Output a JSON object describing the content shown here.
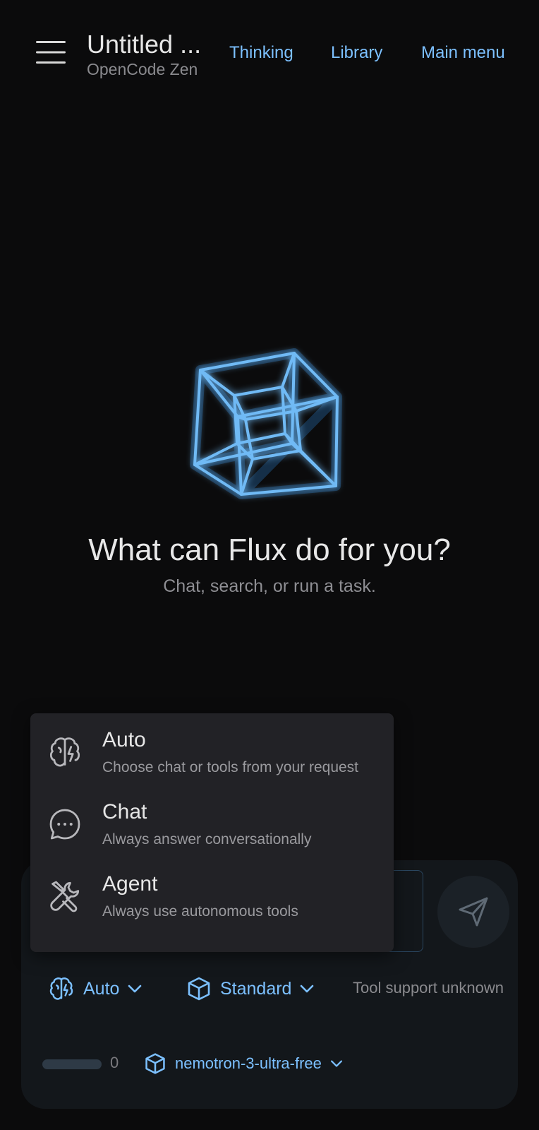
{
  "header": {
    "menu_icon": "hamburger-icon",
    "title": "Untitled ...",
    "subtitle": "OpenCode Zen",
    "nav": {
      "thinking": "Thinking",
      "library": "Library",
      "main_menu": "Main menu"
    }
  },
  "hero": {
    "logo_icon": "tesseract-logo-icon",
    "title": "What can Flux do for you?",
    "subtitle": "Chat, search, or run a task."
  },
  "mode_menu": {
    "items": [
      {
        "label": "Auto",
        "description": "Choose chat or tools from your request",
        "icon": "brain-icon"
      },
      {
        "label": "Chat",
        "description": "Always answer conversationally",
        "icon": "chat-bubble-icon"
      },
      {
        "label": "Agent",
        "description": "Always use autonomous tools",
        "icon": "tools-icon"
      }
    ]
  },
  "composer": {
    "send_icon": "send-icon",
    "mode_select": {
      "label": "Auto",
      "icon": "brain-icon"
    },
    "profile_select": {
      "label": "Standard",
      "icon": "cube-icon"
    },
    "tool_support": "Tool support unknown",
    "context": {
      "count": "0",
      "fill_fraction": 0
    },
    "model_select": {
      "label": "nemotron-3-ultra-free",
      "icon": "cube-icon"
    }
  },
  "colors": {
    "background": "#0b0b0c",
    "accent": "#7cc0ff",
    "panel": "#13171b",
    "menu": "#222226"
  }
}
